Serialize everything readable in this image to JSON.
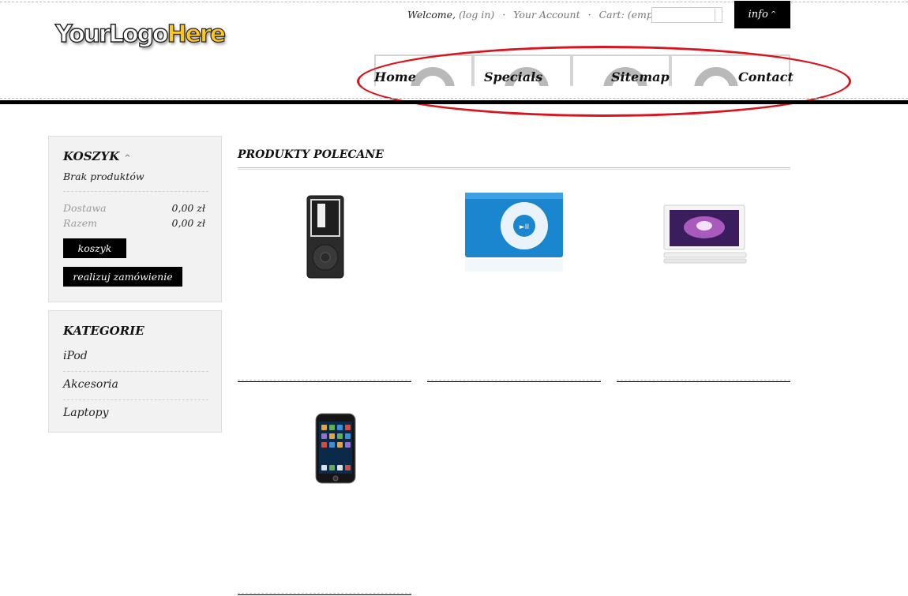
{
  "header": {
    "logo": {
      "part1": "YourLogo",
      "part2": "Here"
    },
    "userbar": {
      "welcome": "Welcome,",
      "login": "(log in)",
      "account": "Your Account",
      "cart": "Cart: (empty)",
      "separator": "·"
    },
    "search": {
      "placeholder": ""
    },
    "info_label": "info",
    "nav": [
      "Home",
      "Specials",
      "Sitemap",
      "Contact"
    ]
  },
  "cart": {
    "title": "KOSZYK",
    "empty": "Brak produktów",
    "shipping_label": "Dostawa",
    "shipping_value": "0,00 zł",
    "total_label": "Razem",
    "total_value": "0,00 zł",
    "cart_button": "koszyk",
    "checkout_button": "realizuj zamówienie"
  },
  "categories": {
    "title": "KATEGORIE",
    "items": [
      "iPod",
      "Akcesoria",
      "Laptopy"
    ]
  },
  "featured": {
    "title": "PRODUKTY POLECANE",
    "products": [
      "ipod-nano-image",
      "ipod-shuffle-image",
      "macbook-image",
      "ipod-touch-image"
    ]
  },
  "colors": {
    "accent": "#000000",
    "annotation": "#d9141c",
    "logo_yellow": "#ffc81c"
  }
}
